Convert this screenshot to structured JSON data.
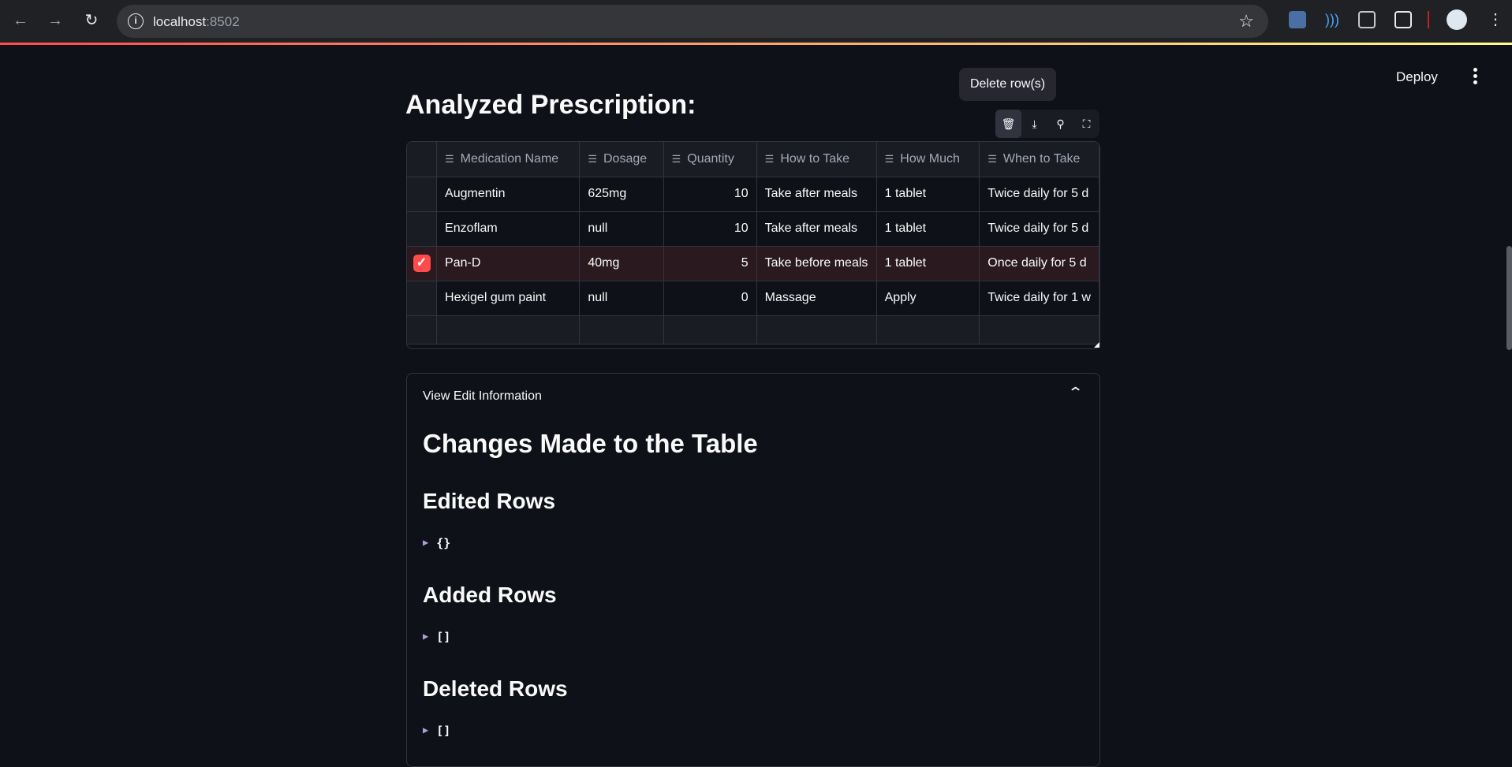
{
  "browser": {
    "url_host": "localhost",
    "url_port": ":8502"
  },
  "header": {
    "deploy_label": "Deploy"
  },
  "tooltip": {
    "text": "Delete row(s)"
  },
  "page": {
    "heading": "Analyzed Prescription:"
  },
  "toolbar": {
    "icons": [
      "trash-icon",
      "download-icon",
      "search-icon",
      "fullscreen-icon"
    ]
  },
  "table": {
    "columns": [
      "Medication Name",
      "Dosage",
      "Quantity",
      "How to Take",
      "How Much",
      "When to Take"
    ],
    "rows": [
      {
        "name": "Augmentin",
        "dosage": "625mg",
        "quantity": "10",
        "how_to_take": "Take after meals",
        "how_much": "1 tablet",
        "when_to_take": "Twice daily for 5 d",
        "selected": false
      },
      {
        "name": "Enzoflam",
        "dosage": "null",
        "quantity": "10",
        "how_to_take": "Take after meals",
        "how_much": "1 tablet",
        "when_to_take": "Twice daily for 5 d",
        "selected": false
      },
      {
        "name": "Pan-D",
        "dosage": "40mg",
        "quantity": "5",
        "how_to_take": "Take before meals",
        "how_much": "1 tablet",
        "when_to_take": "Once daily for 5 d",
        "selected": true
      },
      {
        "name": "Hexigel gum paint",
        "dosage": "null",
        "quantity": "0",
        "how_to_take": "Massage",
        "how_much": "Apply",
        "when_to_take": "Twice daily for 1 w",
        "selected": false
      }
    ]
  },
  "expander": {
    "title": "View Edit Information",
    "heading": "Changes Made to the Table",
    "sections": [
      {
        "title": "Edited Rows",
        "value": "{}"
      },
      {
        "title": "Added Rows",
        "value": "[]"
      },
      {
        "title": "Deleted Rows",
        "value": "[]"
      }
    ]
  },
  "colors": {
    "accent": "#ff4b4b",
    "background": "#0e1117",
    "surface": "#1a1c24",
    "border": "#31333f"
  }
}
